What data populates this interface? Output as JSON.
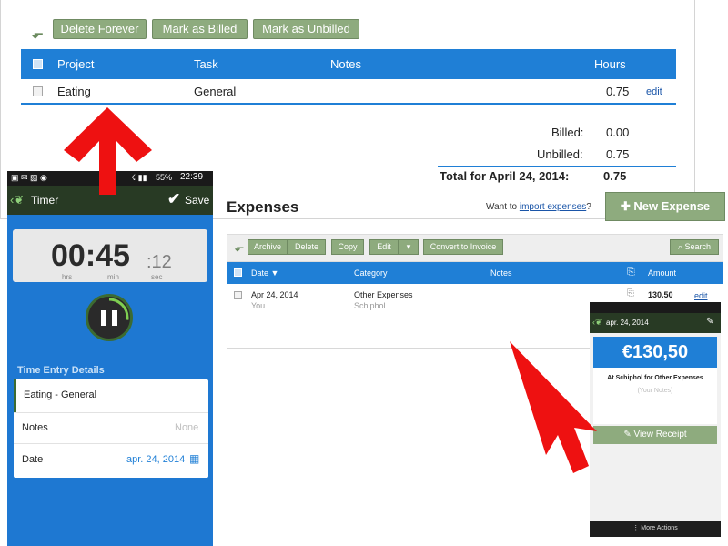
{
  "time_entries": {
    "actions": {
      "delete_forever": "Delete Forever",
      "mark_billed": "Mark as Billed",
      "mark_unbilled": "Mark as Unbilled"
    },
    "headers": {
      "project": "Project",
      "task": "Task",
      "notes": "Notes",
      "hours": "Hours"
    },
    "row": {
      "project": "Eating",
      "task": "General",
      "notes": "",
      "hours": "0.75",
      "edit": "edit"
    },
    "totals": {
      "billed_label": "Billed:",
      "billed_value": "0.00",
      "unbilled_label": "Unbilled:",
      "unbilled_value": "0.75",
      "total_label": "Total for April 24, 2014:",
      "total_value": "0.75"
    }
  },
  "expenses": {
    "title": "Expenses",
    "import_prefix": "Want to",
    "import_link": "import expenses",
    "import_suffix": "?",
    "new_button": "New Expense",
    "toolbar": {
      "archive": "Archive",
      "delete": "Delete",
      "copy": "Copy",
      "edit": "Edit",
      "convert": "Convert to Invoice",
      "search": "Search"
    },
    "headers": {
      "date": "Date ▼",
      "category": "Category",
      "notes": "Notes",
      "amount": "Amount"
    },
    "row": {
      "date": "Apr 24, 2014",
      "user": "You",
      "category": "Other Expenses",
      "location": "Schiphol",
      "amount": "130.50",
      "edit": "edit"
    }
  },
  "phone_timer": {
    "status_time": "22:39",
    "status_battery": "55%",
    "title": "Timer",
    "save": "Save",
    "time_main": "00:45",
    "time_seconds": ":12",
    "unit_hrs": "hrs",
    "unit_min": "min",
    "unit_sec": "sec",
    "section_title": "Time Entry Details",
    "entry": "Eating - General",
    "notes_label": "Notes",
    "notes_value": "None",
    "date_label": "Date",
    "date_value": "apr. 24, 2014"
  },
  "phone_expense": {
    "date": "apr. 24, 2014",
    "amount": "€130,50",
    "description": "At Schiphol for Other Expenses",
    "notes_placeholder": "(Your Notes)",
    "view_receipt": "View Receipt",
    "more_actions": "More Actions"
  },
  "colors": {
    "accent_blue": "#1f7fd6",
    "button_green": "#8eab7e",
    "annotation_red": "#ee1111",
    "dark_bar": "#283a24"
  },
  "icons": [
    "down-arrow-icon",
    "checkbox-icon",
    "plus-icon",
    "search-icon",
    "paperclip-icon",
    "leaf-icon",
    "checkmark-icon",
    "pause-icon",
    "calendar-icon",
    "pencil-icon",
    "receipt-icon",
    "menu-dots-icon"
  ]
}
